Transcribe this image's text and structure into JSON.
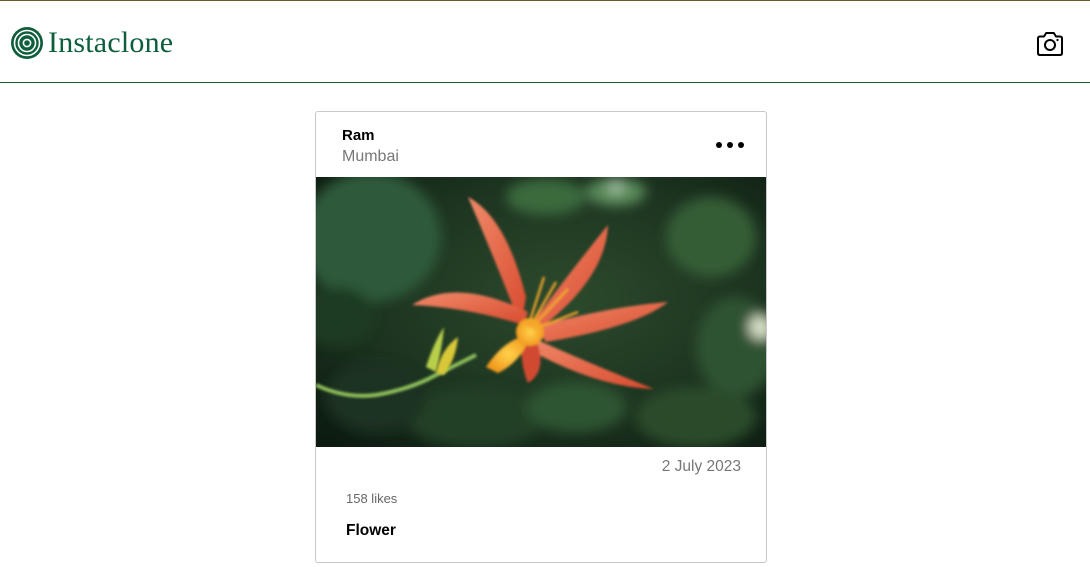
{
  "navbar": {
    "brand_name": "Instaclone",
    "logo_icon": "target-rings-icon",
    "camera_icon": "camera-icon",
    "brand_color": "#0e5e3c",
    "border_color": "#1f5a2a"
  },
  "post": {
    "author_name": "Ram",
    "location": "Mumbai",
    "more_icon": "more-dots-icon",
    "image_alt": "",
    "date": "2 July 2023",
    "likes": "158 likes",
    "caption": "Flower"
  }
}
